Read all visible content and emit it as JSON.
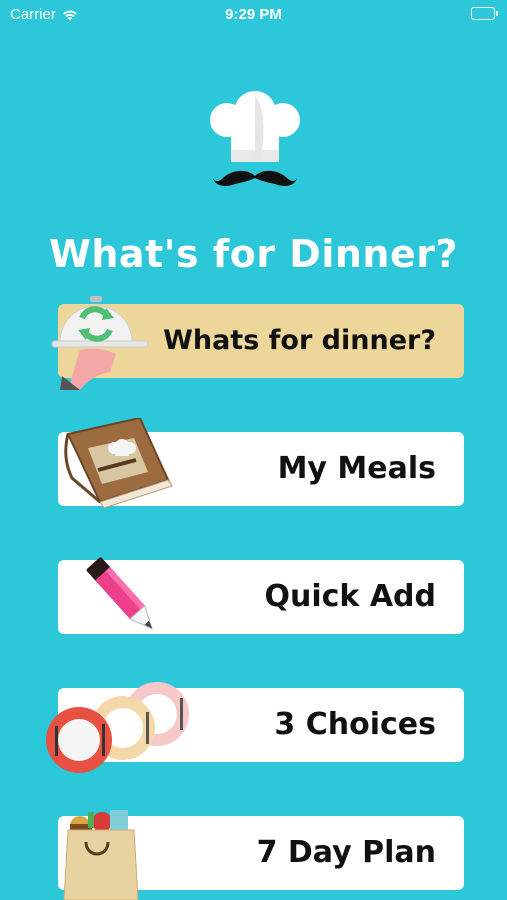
{
  "status_bar": {
    "carrier": "Carrier",
    "time": "9:29 PM"
  },
  "app": {
    "title": "What's for Dinner?"
  },
  "menu": [
    {
      "label": "Whats for dinner?",
      "icon": "serving-cloche-refresh-icon",
      "active": true
    },
    {
      "label": "My Meals",
      "icon": "cook-book-icon",
      "active": false
    },
    {
      "label": "Quick Add",
      "icon": "pencil-icon",
      "active": false
    },
    {
      "label": "3 Choices",
      "icon": "plates-icon",
      "active": false
    },
    {
      "label": "7 Day Plan",
      "icon": "grocery-bag-icon",
      "active": false
    }
  ],
  "colors": {
    "background": "#2cc7d9",
    "active_button": "#ecd69a",
    "button": "#ffffff"
  }
}
